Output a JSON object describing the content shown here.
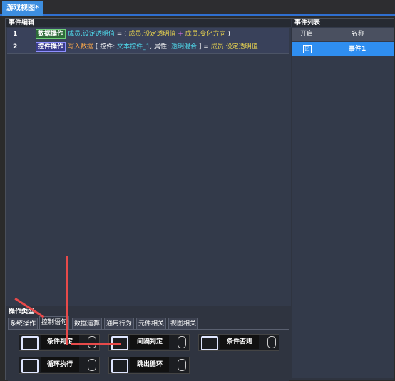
{
  "tabstrip": {
    "active_tab": "游戏视图*"
  },
  "editor": {
    "title": "事件编辑",
    "rows": [
      {
        "num": "1",
        "tag": "数据操作",
        "parts": [
          "成员.设定透明值",
          " = ( ",
          "成员.设定透明值",
          "  +  ",
          "成员.变化方向",
          " )"
        ]
      },
      {
        "num": "2",
        "tag": "控件操作",
        "parts": [
          "写入数据",
          " [ ",
          "控件: ",
          "文本控件_1",
          ", ",
          "属性: ",
          "透明混合",
          " ] = ",
          "成员.设定透明值"
        ]
      }
    ]
  },
  "events": {
    "title": "事件列表",
    "col_enabled": "开启",
    "col_name": "名称",
    "items": [
      {
        "name": "事件1",
        "checked": "☑"
      }
    ]
  },
  "ops": {
    "title": "操作类型",
    "tabs": [
      "系统操作",
      "控制语句",
      "数据运算",
      "通用行为",
      "元件相关",
      "视图相关"
    ],
    "active_tab": "控制语句",
    "buttons": [
      "条件判定",
      "间隔判定",
      "条件否则",
      "循环执行",
      "跳出循环"
    ]
  },
  "colors": {
    "accent": "#2f8ef0",
    "arrow": "#e84a4a"
  }
}
